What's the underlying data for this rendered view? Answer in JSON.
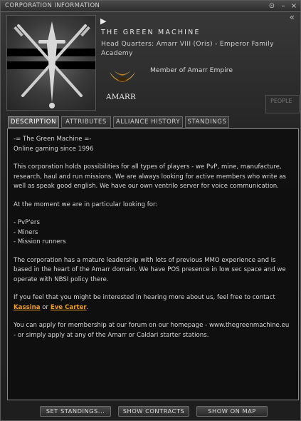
{
  "window": {
    "title": "CORPORATION INFORMATION"
  },
  "header": {
    "corp_name": "THE GREEN MACHINE",
    "hq_label": "Head Quarters: Amarr VIII (Oris) - Emperor Family Academy",
    "faction_name": "AMARR",
    "membership": "Member of Amarr Empire",
    "people_tab": "PEOPLE"
  },
  "tabs": [
    {
      "label": "DESCRIPTION"
    },
    {
      "label": "ATTRIBUTES"
    },
    {
      "label": "ALLIANCE HISTORY"
    },
    {
      "label": "STANDINGS"
    }
  ],
  "description": {
    "intro_line1": "-= The Green Machine =-",
    "intro_line2": "Online gaming since 1996",
    "para1": "This corporation holds possibilities for all types of players - we PvP, mine, manufacture, research, haul and run missions. We are always looking for active members who write as well as speak good english. We have our own ventrilo server for voice communication.",
    "para2": "At the moment we are in particular looking for:",
    "list": [
      "- PvP'ers",
      "- Miners",
      "- Mission runners"
    ],
    "para3": "The corporation has a mature leadership with lots of previous MMO experience and is based in the heart of the Amarr domain. We have POS presence in low sec space and we operate with NBSI policy there.",
    "para4_prefix": "If you feel that you might be interested in hearing more about us, feel free to contact ",
    "contact1": "Kassina",
    "para4_mid": " or ",
    "contact2": "Eve Carter",
    "para4_suffix": ".",
    "para5": "You can apply for membership at our forum on our homepage - www.thegreenmachine.eu - or simply apply at any of the Amarr or Caldari starter stations."
  },
  "buttons": {
    "set_standings": "SET STANDINGS...",
    "show_contracts": "SHOW CONTRACTS",
    "show_on_map": "SHOW ON MAP"
  },
  "colors": {
    "link": "#f0a020",
    "border": "#8a8a8a"
  }
}
